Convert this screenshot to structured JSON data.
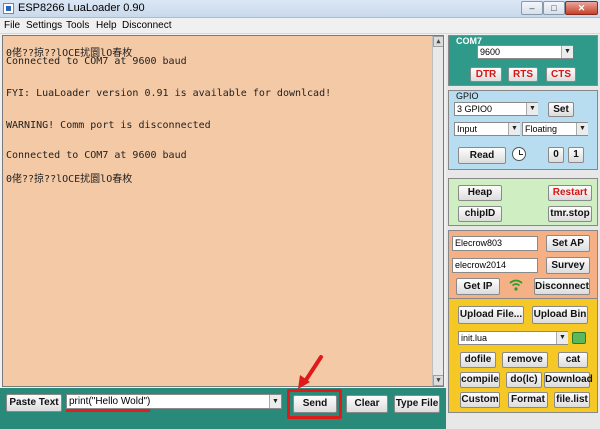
{
  "window": {
    "title": "ESP8266 LuaLoader 0.90",
    "min_glyph": "–",
    "max_glyph": "□",
    "close_glyph": "✕"
  },
  "menu": [
    "File",
    "Settings",
    "Tools",
    "Help",
    "Disconnect"
  ],
  "terminal": {
    "lines": [
      "0佬??掠??lOCE扰圜lO春枚",
      "Connected to COM7 at 9600 baud",
      "FYI: LuaLoader version 0.91 is available for downlcad!",
      "WARNING! Comm port is disconnected",
      "Connected to COM7 at 9600 baud",
      "0佬??掠??lOCE扰圜lO春枚"
    ]
  },
  "bottom": {
    "paste_text": "Paste Text",
    "command_value": "print(\"Hello Wold\")",
    "send": "Send",
    "clear": "Clear",
    "type_file": "Type File"
  },
  "com": {
    "label": "COM7",
    "baud": "9600",
    "dtr": "DTR",
    "rts": "RTS",
    "cts": "CTS"
  },
  "gpio": {
    "label": "GPIO",
    "pin": "3 GPIO0",
    "set": "Set",
    "mode": "Input",
    "pull": "Floating",
    "read": "Read",
    "zero": "0",
    "one": "1"
  },
  "heap": {
    "heap": "Heap",
    "restart": "Restart",
    "chipid": "chipID",
    "tmrstop": "tmr.stop"
  },
  "wifi": {
    "ssid": "Elecrow803",
    "password": "elecrow2014",
    "set_ap": "Set AP",
    "survey": "Survey",
    "get_ip": "Get IP",
    "disconnect": "Disconnect"
  },
  "files": {
    "upload_file": "Upload File...",
    "upload_bin": "Upload Bin",
    "selected_file": "init.lua",
    "dofile": "dofile",
    "remove": "remove",
    "cat": "cat",
    "compile": "compile",
    "dolc": "do(lc)",
    "download": "Download",
    "custom": "Custom",
    "format": "Format",
    "filelist": "file.list"
  },
  "colors": {
    "terminal_bg": "#f4c9a5",
    "accent_teal": "#2f9a8a",
    "highlight_red": "#e01a1a",
    "file_panel": "#f6c825"
  }
}
